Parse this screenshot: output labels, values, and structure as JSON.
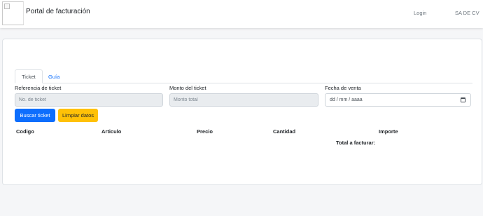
{
  "navbar": {
    "brand": "Portal de facturación",
    "login": "Login",
    "company": "SA DE CV"
  },
  "tabs": [
    {
      "label": "Ticket",
      "active": true
    },
    {
      "label": "Guía",
      "active": false
    }
  ],
  "form": {
    "reference_label": "Referencia de ticket",
    "reference_placeholder": "No. de ticket",
    "amount_label": "Monto del ticket",
    "amount_placeholder": "Monto total",
    "date_label": "Fecha de venta",
    "date_value": "dd / mm / aaaa"
  },
  "buttons": {
    "search": "Buscar ticket",
    "clear": "Limpiar datos"
  },
  "table": {
    "headers": [
      "Codigo",
      "Articulo",
      "Precio",
      "Cantidad",
      "Importe"
    ],
    "total_label": "Total a facturar:"
  },
  "colors": {
    "primary": "#0d6efd",
    "warning": "#ffc107",
    "background": "#f5f6f8"
  }
}
